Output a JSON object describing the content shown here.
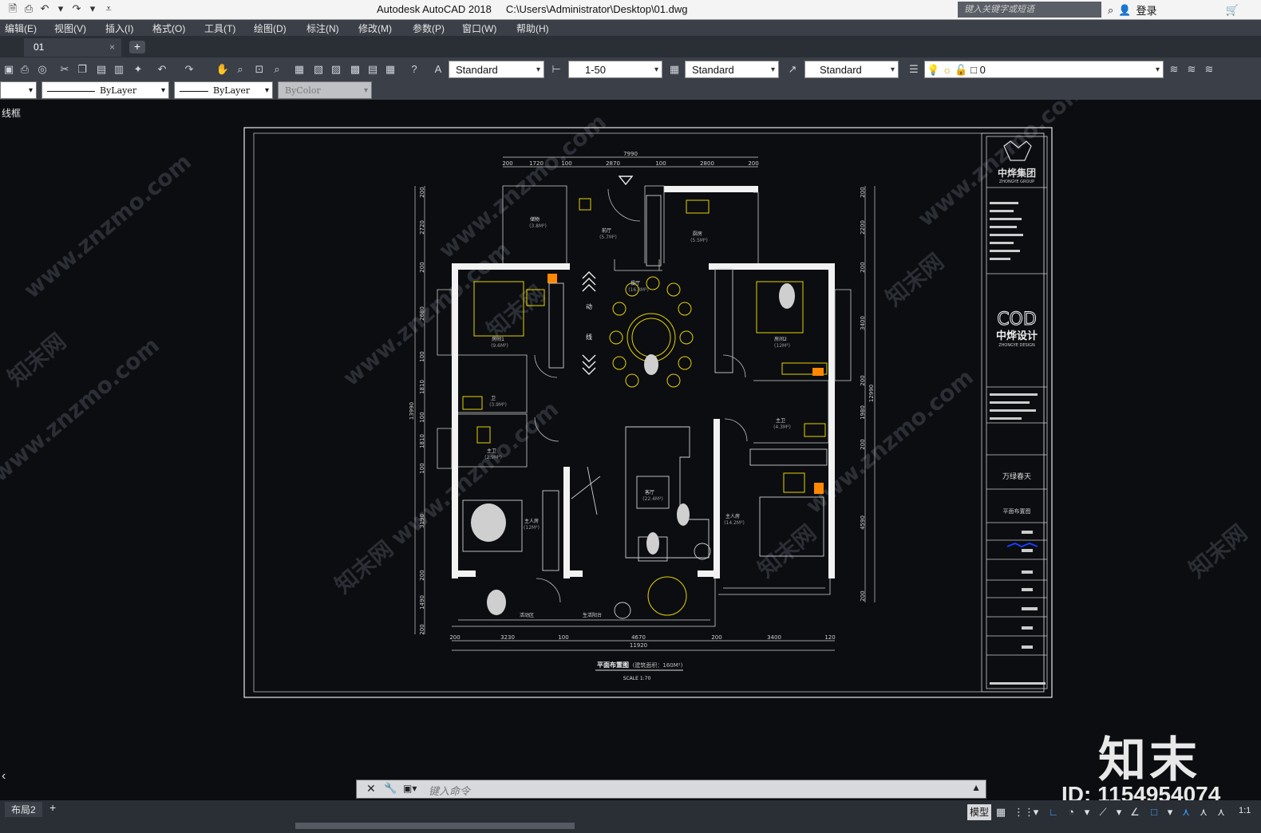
{
  "titlebar": {
    "app_title": "Autodesk AutoCAD 2018",
    "file_path": "C:\\Users\\Administrator\\Desktop\\01.dwg",
    "search_placeholder": "键入关键字或短语",
    "login_label": "登录"
  },
  "menu": [
    "编辑(E)",
    "视图(V)",
    "插入(I)",
    "格式(O)",
    "工具(T)",
    "绘图(D)",
    "标注(N)",
    "修改(M)",
    "参数(P)",
    "窗口(W)",
    "帮助(H)"
  ],
  "tabs": {
    "active": "01"
  },
  "toolbar": {
    "text_style": "Standard",
    "dim_style": "1-50",
    "table_style": "Standard",
    "multileader_style": "Standard",
    "layer": "0"
  },
  "properties": {
    "linetype": "ByLayer",
    "lineweight": "ByLayer",
    "plot_style": "ByColor"
  },
  "viewport_label": "线框",
  "drawing": {
    "dims_top": [
      "7990",
      "200",
      "1720",
      "100",
      "2870",
      "100",
      "2800",
      "200"
    ],
    "dims_bottom": [
      "11920",
      "200",
      "3230",
      "100",
      "4670",
      "200",
      "3400",
      "120"
    ],
    "dims_left": [
      "13990",
      "200",
      "2720",
      "200",
      "2680",
      "100",
      "1810",
      "100",
      "1810",
      "100",
      "3190",
      "200",
      "1490",
      "200"
    ],
    "dims_right": [
      "12990",
      "200",
      "2200",
      "200",
      "3400",
      "200",
      "1980",
      "200",
      "4590",
      "200"
    ],
    "rooms": [
      {
        "name": "储物",
        "area": "(3.8M²)"
      },
      {
        "name": "前厅",
        "area": "(5.7M²)"
      },
      {
        "name": "厨房",
        "area": "(5.5M²)"
      },
      {
        "name": "餐厅",
        "area": "(16.3M²)"
      },
      {
        "name": "房间1",
        "area": "(9.6M²)"
      },
      {
        "name": "房间2",
        "area": "(12M²)"
      },
      {
        "name": "卫",
        "area": "(3.9M²)"
      },
      {
        "name": "主卫",
        "area": "(2.9M²)"
      },
      {
        "name": "主卫",
        "area": "(4.3M²)"
      },
      {
        "name": "客厅",
        "area": "(22.4M²)"
      },
      {
        "name": "主人房",
        "area": "(12M²)"
      },
      {
        "name": "主人房",
        "area": "(14.2M²)"
      },
      {
        "name": "活动区",
        "area": ""
      },
      {
        "name": "生活阳台",
        "area": ""
      }
    ],
    "flow_labels": [
      "动",
      "线"
    ],
    "plan_title": "平面布置图",
    "plan_area": "(建筑面积：160M²)",
    "plan_scale": "SCALE 1:70",
    "titleblock": {
      "company_cn": "中烨集团",
      "company_en": "ZHONGYE GROUP",
      "design_logo": "COD",
      "design_cn": "中烨设计",
      "design_en": "ZHONGYE DESIGN",
      "project": "万绿春天",
      "drawing_name": "平面布置图"
    }
  },
  "watermark": {
    "brand": "知末",
    "id_text": "ID: 1154954074",
    "site": "www.znzmo.com",
    "site_cn": "知末网"
  },
  "command": {
    "placeholder": "键入命令"
  },
  "status": {
    "layout_tab": "布局2",
    "model_btn": "模型",
    "scale": "1:1"
  }
}
